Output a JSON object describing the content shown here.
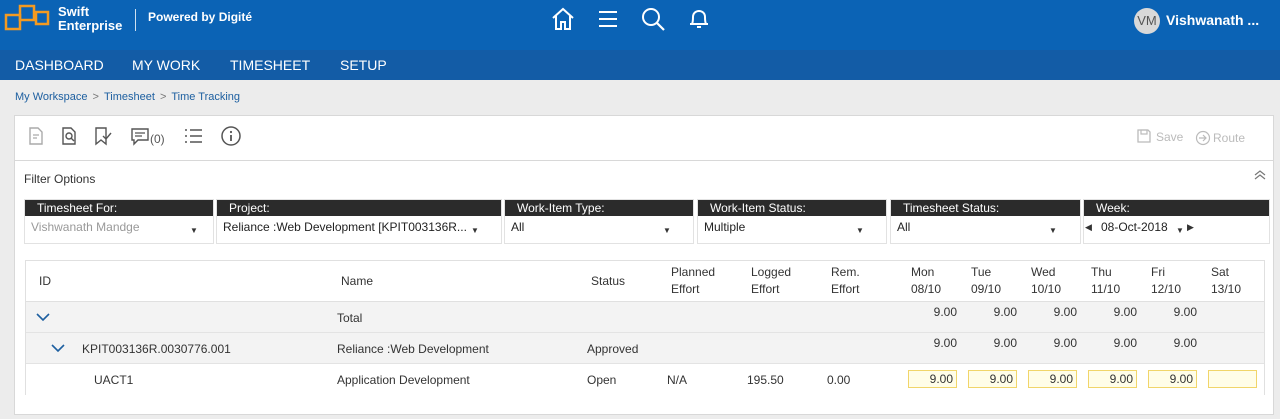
{
  "header": {
    "brand_line1": "Swift",
    "brand_line2": "Enterprise",
    "powered_by": "Powered by Digité",
    "user_initials": "VM",
    "user_name": "Vishwanath ...",
    "icons": [
      "home-icon",
      "menu-icon",
      "search-icon",
      "bell-icon"
    ]
  },
  "nav": {
    "items": [
      "DASHBOARD",
      "MY WORK",
      "TIMESHEET",
      "SETUP"
    ]
  },
  "breadcrumb": {
    "items": [
      "My Workspace",
      "Timesheet",
      "Time Tracking"
    ]
  },
  "toolbar": {
    "comment_count": "(0)",
    "save_label": "Save",
    "route_label": "Route"
  },
  "filters": {
    "title": "Filter Options",
    "timesheet_for": {
      "label": "Timesheet For:",
      "value": "Vishwanath Mandge"
    },
    "project": {
      "label": "Project:",
      "value": "Reliance :Web Development [KPIT003136R..."
    },
    "work_item_type": {
      "label": "Work-Item Type:",
      "value": "All"
    },
    "work_item_status": {
      "label": "Work-Item Status:",
      "value": "Multiple"
    },
    "timesheet_status": {
      "label": "Timesheet Status:",
      "value": "All"
    },
    "week": {
      "label": "Week:",
      "value": "08-Oct-2018"
    }
  },
  "grid": {
    "headers": {
      "id": "ID",
      "name": "Name",
      "status": "Status",
      "planned_1": "Planned",
      "planned_2": "Effort",
      "logged_1": "Logged",
      "logged_2": "Effort",
      "rem_1": "Rem.",
      "rem_2": "Effort",
      "days": [
        {
          "day": "Mon",
          "date": "08/10"
        },
        {
          "day": "Tue",
          "date": "09/10"
        },
        {
          "day": "Wed",
          "date": "10/10"
        },
        {
          "day": "Thu",
          "date": "11/10"
        },
        {
          "day": "Fri",
          "date": "12/10"
        },
        {
          "day": "Sat",
          "date": "13/10"
        }
      ]
    },
    "total_row": {
      "name": "Total",
      "days": [
        "9.00",
        "9.00",
        "9.00",
        "9.00",
        "9.00"
      ]
    },
    "project_row": {
      "id": "KPIT003136R.0030776.001",
      "name": "Reliance :Web Development",
      "status": "Approved",
      "days": [
        "9.00",
        "9.00",
        "9.00",
        "9.00",
        "9.00"
      ]
    },
    "task_row": {
      "id": "UACT1",
      "name": "Application Development",
      "status": "Open",
      "planned": "N/A",
      "logged": "195.50",
      "remaining": "0.00",
      "days": [
        "9.00",
        "9.00",
        "9.00",
        "9.00",
        "9.00",
        ""
      ]
    }
  },
  "colors": {
    "topbar": "#0b63b5",
    "navbar": "#135ca6",
    "logo_orange": "#f39a21",
    "filter_label_bg": "#2b2b2b",
    "input_border": "#f1d56a"
  }
}
